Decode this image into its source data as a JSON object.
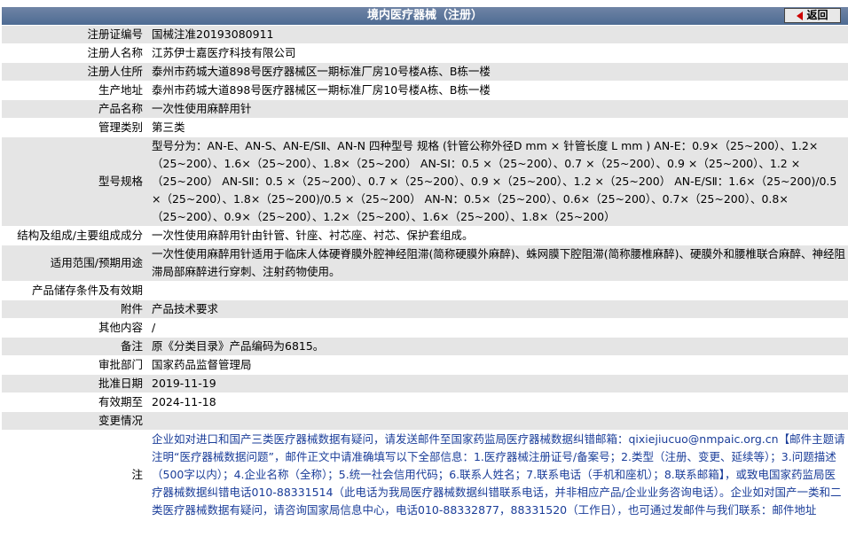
{
  "header": {
    "title": "境内医疗器械（注册）",
    "back_label": "返回"
  },
  "rows": [
    {
      "key": "注册证编号",
      "value": "国械注准20193080911"
    },
    {
      "key": "注册人名称",
      "value": "江苏伊士嘉医疗科技有限公司"
    },
    {
      "key": "注册人住所",
      "value": "泰州市药城大道898号医疗器械区一期标准厂房10号楼A栋、B栋一楼"
    },
    {
      "key": "生产地址",
      "value": "泰州市药城大道898号医疗器械区一期标准厂房10号楼A栋、B栋一楼"
    },
    {
      "key": "产品名称",
      "value": "一次性使用麻醉用针"
    },
    {
      "key": "管理类别",
      "value": "第三类"
    },
    {
      "key": "型号规格",
      "value": "型号分为：AN-E、AN-S、AN-E/SⅡ、AN-N 四种型号 规格 (针管公称外径D mm × 针管长度 L mm ) AN-E：0.9×（25~200）、1.2×（25~200）、1.6×（25~200）、1.8×（25~200） AN-SⅠ：0.5 ×（25~200）、0.7 ×（25~200）、0.9 ×（25~200）、1.2 ×（25~200） AN-SⅡ：0.5 ×（25~200）、0.7 ×（25~200）、0.9 ×（25~200）、1.2 ×（25~200） AN-E/SⅡ：1.6×（25~200)/0.5 ×（25~200）、1.8×（25~200)/0.5 ×（25~200） AN-N：0.5×（25~200）、0.6×（25~200）、0.7×（25~200）、0.8×（25~200）、0.9×（25~200）、1.2×（25~200）、1.6×（25~200）、1.8×（25~200）"
    },
    {
      "key": "结构及组成/主要组成成分",
      "value": "一次性使用麻醉用针由针管、针座、衬芯座、衬芯、保护套组成。"
    },
    {
      "key": "适用范围/预期用途",
      "value": "一次性使用麻醉用针适用于临床人体硬脊膜外腔神经阻滞(简称硬膜外麻醉)、蛛网膜下腔阻滞(简称腰椎麻醉)、硬膜外和腰椎联合麻醉、神经阻滞局部麻醉进行穿刺、注射药物使用。"
    },
    {
      "key": "产品储存条件及有效期",
      "value": ""
    },
    {
      "key": "附件",
      "value": "产品技术要求"
    },
    {
      "key": "其他内容",
      "value": "/"
    },
    {
      "key": "备注",
      "value": "原《分类目录》产品编码为6815。"
    },
    {
      "key": "审批部门",
      "value": "国家药品监督管理局"
    },
    {
      "key": "批准日期",
      "value": "2019-11-19"
    },
    {
      "key": "有效期至",
      "value": "2024-11-18"
    },
    {
      "key": "变更情况",
      "value": ""
    }
  ],
  "note": {
    "key": "注",
    "value": "企业如对进口和国产三类医疗器械数据有疑问，请发送邮件至国家药监局医疗器械数据纠错邮箱：qixiejiucuo@nmpaic.org.cn【邮件主题请注明“医疗器械数据问题”，邮件正文中请准确填写以下全部信息：1.医疗器械注册证号/备案号；2.类型（注册、变更、延续等）；3.问题描述（500字以内）；4.企业名称（全称）；5.统一社会信用代码；6.联系人姓名；7.联系电话（手机和座机）；8.联系邮箱】，或致电国家药监局医疗器械数据纠错电话010-88331514（此电话为我局医疗器械数据纠错联系电话，并非相应产品/企业业务咨询电话）。企业如对国产一类和二类医疗器械数据有疑问，请咨询国家局信息中心，电话010-88332877，88331520（工作日），也可通过发邮件与我们联系：邮件地址"
  }
}
